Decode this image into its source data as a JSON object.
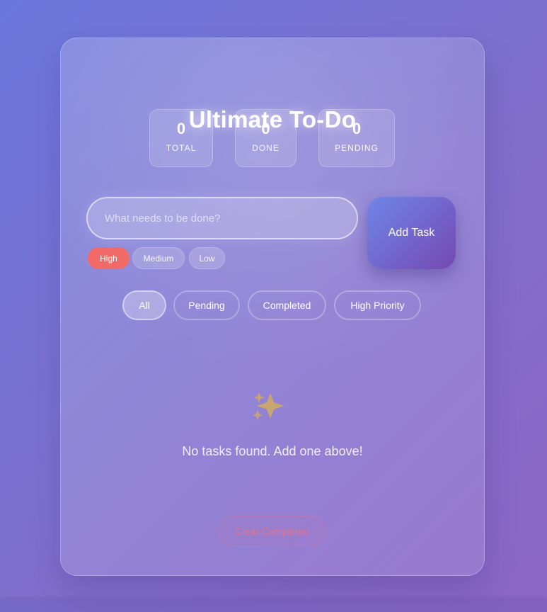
{
  "app": {
    "title": "Ultimate To-Do"
  },
  "stats": [
    {
      "label": "TOTAL",
      "value": "0"
    },
    {
      "label": "DONE",
      "value": "0"
    },
    {
      "label": "PENDING",
      "value": "0"
    }
  ],
  "new_task": {
    "placeholder": "What needs to be done?",
    "value": "",
    "add_label": "Add Task"
  },
  "priorities": {
    "options": [
      "High",
      "Medium",
      "Low"
    ],
    "selected": "High"
  },
  "filters": {
    "options": [
      "All",
      "Pending",
      "Completed",
      "High Priority"
    ],
    "selected": "All"
  },
  "empty_state": {
    "icon": "sparkles-icon",
    "message": "No tasks found. Add one above!"
  },
  "actions": {
    "clear_completed": "Clear Completed"
  },
  "colors": {
    "background_start": "#6a78dc",
    "background_end": "#8d66c6",
    "priority_high": "#f26a67",
    "add_button_start": "#6f86e8",
    "add_button_end": "#7548b2",
    "sparkle": "#c8a66f",
    "clear_text": "#fd727c"
  }
}
